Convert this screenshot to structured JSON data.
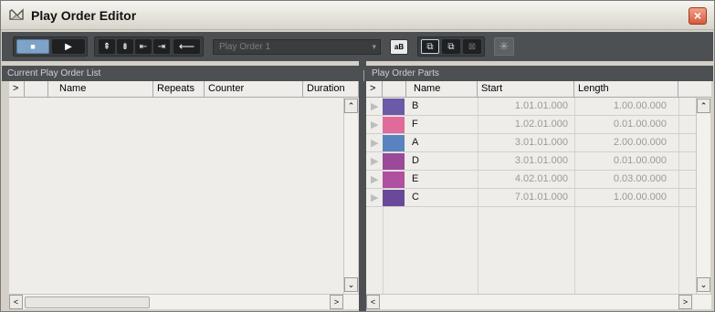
{
  "window": {
    "title": "Play Order Editor",
    "close_label": "×"
  },
  "toolbar": {
    "stop_glyph": "■",
    "play_glyph": "▶",
    "move_up_glyph": "⇞",
    "move_down_glyph": "⇟",
    "move_left_glyph": "⇤",
    "move_right_glyph": "⇥",
    "append_glyph": "⟵",
    "play_order_select": "Play Order 1",
    "select_arrow": "▾",
    "rename_glyph": "aB",
    "add_glyph": "⧉",
    "duplicate_glyph": "⧉",
    "remove_glyph": "⊠",
    "flatten_glyph": "✳"
  },
  "left_pane": {
    "title": "Current Play Order List",
    "columns": [
      "",
      "",
      "Name",
      "Repeats",
      "Counter",
      "Duration"
    ],
    "expand_glyph": ">"
  },
  "right_pane": {
    "title": "Play Order Parts",
    "columns": [
      "",
      "",
      "Name",
      "Start",
      "Length"
    ],
    "expand_glyph": ">",
    "rows": [
      {
        "name": "B",
        "start": "1.01.01.000",
        "length": "1.00.00.000",
        "color": "#6a5aa8"
      },
      {
        "name": "F",
        "start": "1.02.01.000",
        "length": "0.01.00.000",
        "color": "#e06a9a"
      },
      {
        "name": "A",
        "start": "3.01.01.000",
        "length": "2.00.00.000",
        "color": "#5a82c0"
      },
      {
        "name": "D",
        "start": "3.01.01.000",
        "length": "0.01.00.000",
        "color": "#9a4a98"
      },
      {
        "name": "E",
        "start": "4.02.01.000",
        "length": "0.03.00.000",
        "color": "#b050a0"
      },
      {
        "name": "C",
        "start": "7.01.01.000",
        "length": "1.00.00.000",
        "color": "#6a4a98"
      }
    ],
    "row_arrow": "▶"
  },
  "scroll": {
    "up": "⌃",
    "down": "⌄",
    "left": "<",
    "right": ">"
  }
}
